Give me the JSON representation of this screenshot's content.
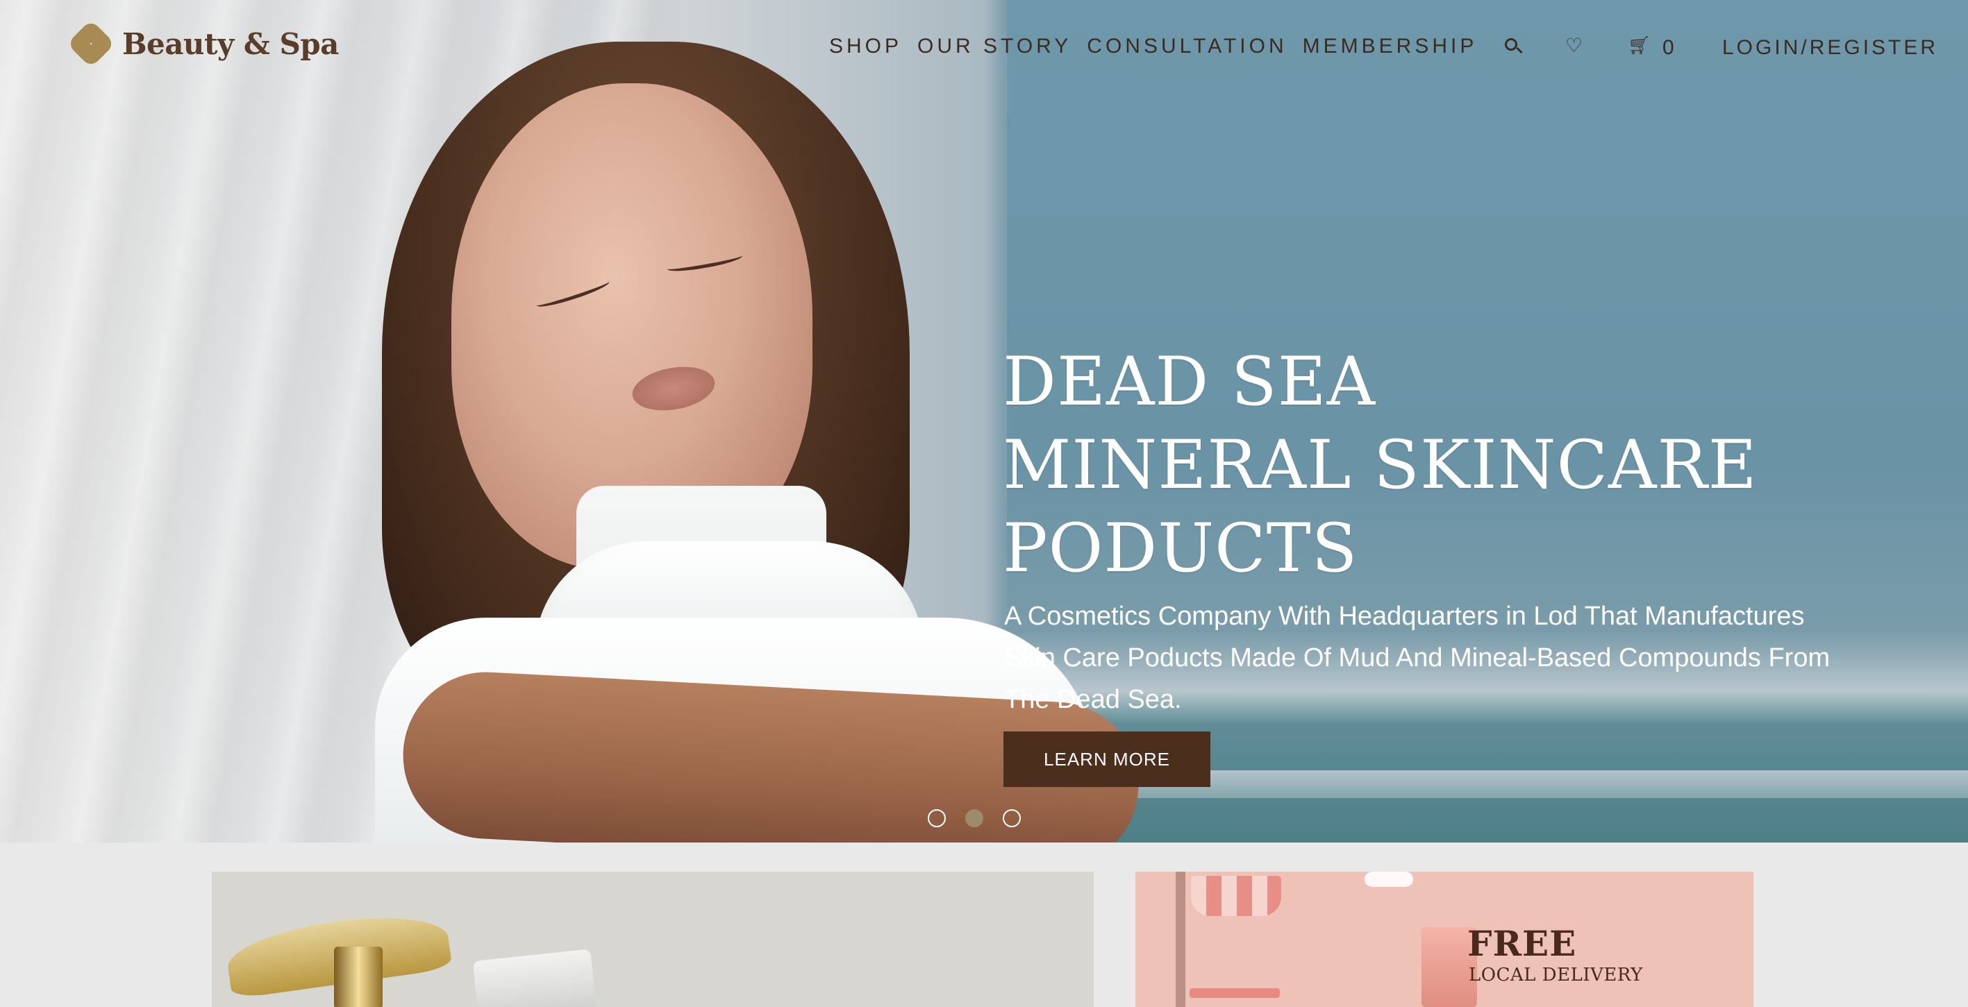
{
  "brand": {
    "name": "Beauty & Spa"
  },
  "nav": {
    "items": [
      "SHOP",
      "OUR STORY",
      "CONSULTATION",
      "MEMBERSHIP"
    ],
    "cart_count": "0",
    "login_label": "LOGIN/REGISTER",
    "icons": [
      "search-icon",
      "heart-icon",
      "cart-icon"
    ]
  },
  "hero": {
    "title_lines": [
      "DEAD SEA",
      "MINERAL SKINCARE",
      "PODUCTS"
    ],
    "subtitle": "A Cosmetics Company With Headquarters in Lod That Manufactures Skin Care Poducts Made Of Mud And Mineal-Based Compounds From The Dead Sea.",
    "cta_label": "LEARN MORE",
    "slides": 3,
    "active_slide": 2
  },
  "promos": {
    "right": {
      "title": "FREE",
      "subtitle": "LOCAL DELIVERY"
    }
  },
  "colors": {
    "brand_gold": "#a88b52",
    "cta_brown": "#4b2e1c",
    "nav_text": "#3b2a20",
    "promo_pink": "#efc2b7"
  }
}
